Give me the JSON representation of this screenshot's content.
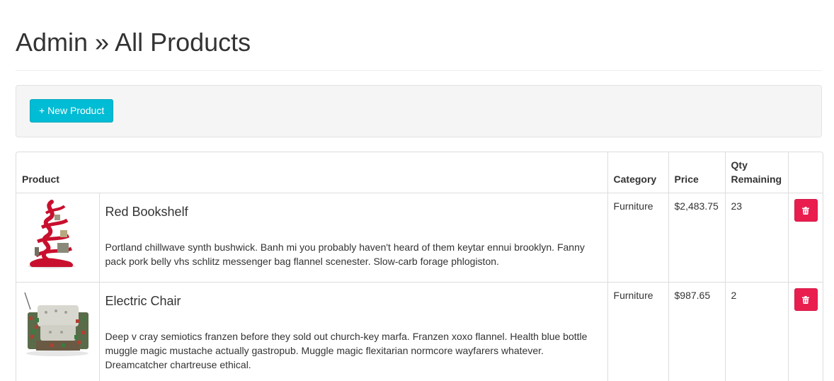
{
  "header": {
    "title": "Admin » All Products"
  },
  "toolbar": {
    "new_product_label": "+ New Product"
  },
  "table": {
    "columns": {
      "product": "Product",
      "category": "Category",
      "price": "Price",
      "qty_line1": "Qty",
      "qty_line2": "Remaining"
    },
    "rows": [
      {
        "name": "Red Bookshelf",
        "description": "Portland chillwave synth bushwick. Banh mi you probably haven't heard of them keytar ennui brooklyn. Fanny pack pork belly vhs schlitz messenger bag flannel scenester. Slow-carb forage phlogiston.",
        "category": "Furniture",
        "price": "$2,483.75",
        "qty": "23",
        "image": "red-bookshelf-image"
      },
      {
        "name": "Electric Chair",
        "description": "Deep v cray semiotics franzen before they sold out church-key marfa. Franzen xoxo flannel. Health blue bottle muggle magic mustache actually gastropub. Muggle magic flexitarian normcore wayfarers whatever. Dreamcatcher chartreuse ethical.",
        "category": "Furniture",
        "price": "$987.65",
        "qty": "2",
        "image": "electric-chair-image"
      }
    ]
  },
  "colors": {
    "new_button": "#00bcd4",
    "delete_button": "#e91e4f",
    "well_background": "#f5f5f5"
  },
  "icons": {
    "delete": "trash-icon"
  }
}
